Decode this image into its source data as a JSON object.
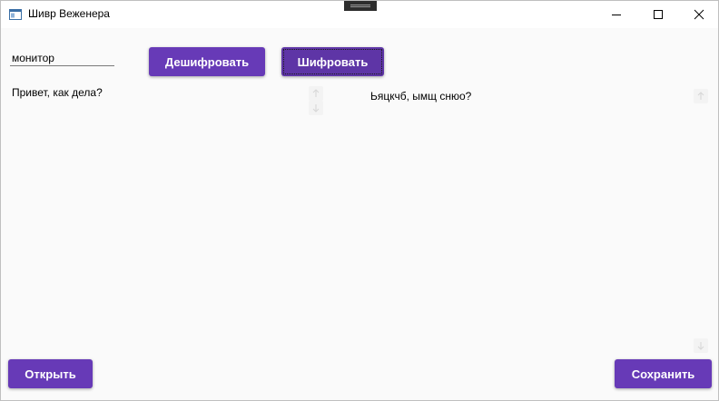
{
  "window": {
    "title": "Шивр Веженера"
  },
  "toolbar": {
    "key_value": "монитор",
    "decrypt_label": "Дешифровать",
    "encrypt_label": "Шифровать"
  },
  "editor": {
    "input_text": "Привет, как дела?",
    "output_text": "Ьяцкчб, ымщ снюо?"
  },
  "footer": {
    "open_label": "Открыть",
    "save_label": "Сохранить"
  },
  "colors": {
    "accent": "#673ab7",
    "background": "#fafafa"
  },
  "icons": {
    "app": "window-app-icon",
    "minimize": "minimize-icon",
    "maximize": "maximize-icon",
    "close": "close-icon",
    "scroll_up": "arrow-up-icon",
    "scroll_down": "arrow-down-icon"
  }
}
